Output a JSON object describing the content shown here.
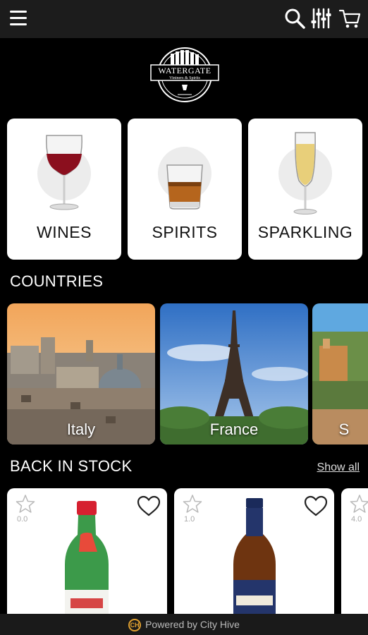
{
  "topbar": {
    "menu_icon": "hamburger-icon",
    "search_icon": "search-icon",
    "filter_icon": "filter-sliders-icon",
    "cart_icon": "cart-icon"
  },
  "logo": {
    "icon": "watergate-logo",
    "text_main": "WATERGATE",
    "text_sub": "Vintners & Spirits"
  },
  "categories": [
    {
      "label": "WINES",
      "icon": "red-wine-glass-icon"
    },
    {
      "label": "SPIRITS",
      "icon": "whiskey-tumbler-icon"
    },
    {
      "label": "SPARKLING",
      "icon": "champagne-flute-icon"
    }
  ],
  "countries_section": {
    "title": "COUNTRIES"
  },
  "countries": [
    {
      "name": "Italy"
    },
    {
      "name": "France"
    },
    {
      "name": "S"
    }
  ],
  "back_in_stock": {
    "title": "BACK IN STOCK",
    "show_all": "Show all",
    "products": [
      {
        "rating": "0.0",
        "icon": "soju-bottle"
      },
      {
        "rating": "1.0",
        "icon": "beer-bottle"
      },
      {
        "rating": "4.0",
        "icon": "bottle"
      }
    ]
  },
  "footer": {
    "badge": "CH",
    "text": "Powered by City Hive"
  },
  "colors": {
    "background": "#000000",
    "topbar": "#1c1c1c",
    "card": "#ffffff",
    "wine_red": "#8b0f1e",
    "whiskey_amber": "#b5651d",
    "accent_gold": "#e0a030"
  }
}
